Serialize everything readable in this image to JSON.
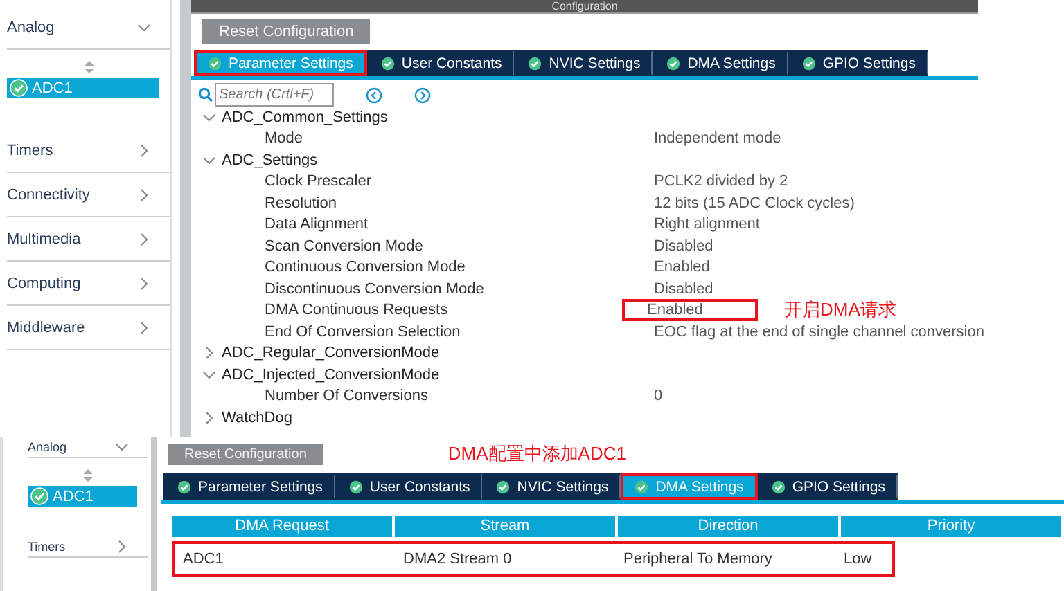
{
  "top": {
    "header_title": "Configuration",
    "sidebar": {
      "groups": [
        {
          "label": "Analog",
          "expanded": true,
          "items": [
            {
              "label": "ADC1",
              "selected": true
            }
          ]
        },
        {
          "label": "Timers",
          "expanded": false
        },
        {
          "label": "Connectivity",
          "expanded": false
        },
        {
          "label": "Multimedia",
          "expanded": false
        },
        {
          "label": "Computing",
          "expanded": false
        },
        {
          "label": "Middleware",
          "expanded": false
        }
      ]
    },
    "reset_button": "Reset Configuration",
    "tabs": [
      {
        "label": "Parameter Settings",
        "selected": true,
        "highlighted": true
      },
      {
        "label": "User Constants",
        "selected": false,
        "highlighted": false
      },
      {
        "label": "NVIC Settings",
        "selected": false,
        "highlighted": false
      },
      {
        "label": "DMA Settings",
        "selected": false,
        "highlighted": false
      },
      {
        "label": "GPIO Settings",
        "selected": false,
        "highlighted": false
      }
    ],
    "search": {
      "placeholder": "Search (Crtl+F)"
    },
    "tree": [
      {
        "label": "ADC_Common_Settings",
        "expanded": true,
        "children": [
          {
            "name": "Mode",
            "value": "Independent mode",
            "highlighted": false
          }
        ]
      },
      {
        "label": "ADC_Settings",
        "expanded": true,
        "children": [
          {
            "name": "Clock Prescaler",
            "value": "PCLK2 divided by 2",
            "highlighted": false
          },
          {
            "name": "Resolution",
            "value": "12 bits (15 ADC Clock cycles)",
            "highlighted": false
          },
          {
            "name": "Data Alignment",
            "value": "Right alignment",
            "highlighted": false
          },
          {
            "name": "Scan Conversion Mode",
            "value": "Disabled",
            "highlighted": false
          },
          {
            "name": "Continuous Conversion Mode",
            "value": "Enabled",
            "highlighted": false
          },
          {
            "name": "Discontinuous Conversion Mode",
            "value": "Disabled",
            "highlighted": false
          },
          {
            "name": "DMA Continuous Requests",
            "value": "Enabled",
            "highlighted": true,
            "note": "开启DMA请求"
          },
          {
            "name": "End Of Conversion Selection",
            "value": "EOC flag at the end of single channel conversion",
            "highlighted": false
          }
        ]
      },
      {
        "label": "ADC_Regular_ConversionMode",
        "expanded": false
      },
      {
        "label": "ADC_Injected_ConversionMode",
        "expanded": true,
        "children": [
          {
            "name": "Number Of Conversions",
            "value": "0",
            "highlighted": false
          }
        ]
      },
      {
        "label": "WatchDog",
        "expanded": false
      }
    ]
  },
  "bottom": {
    "sidebar": {
      "groups": [
        {
          "label": "Analog",
          "expanded": true,
          "items": [
            {
              "label": "ADC1",
              "selected": true
            }
          ]
        },
        {
          "label": "Timers",
          "expanded": false
        }
      ]
    },
    "reset_button": "Reset Configuration",
    "note": "DMA配置中添加ADC1",
    "tabs": [
      {
        "label": "Parameter Settings",
        "selected": false,
        "highlighted": false
      },
      {
        "label": "User Constants",
        "selected": false,
        "highlighted": false
      },
      {
        "label": "NVIC Settings",
        "selected": false,
        "highlighted": false
      },
      {
        "label": "DMA Settings",
        "selected": true,
        "highlighted": true
      },
      {
        "label": "GPIO Settings",
        "selected": false,
        "highlighted": false
      }
    ],
    "table": {
      "columns": [
        "DMA Request",
        "Stream",
        "Direction",
        "Priority"
      ],
      "rows": [
        {
          "cells": [
            "ADC1",
            "DMA2 Stream 0",
            "Peripheral To Memory",
            "Low"
          ],
          "highlighted": true
        }
      ]
    }
  }
}
